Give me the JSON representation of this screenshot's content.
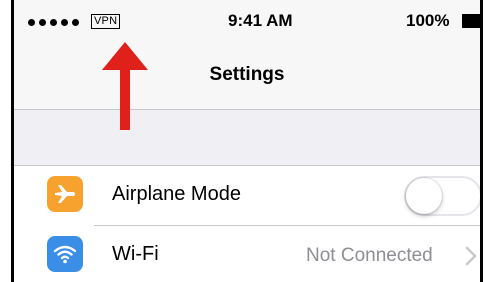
{
  "status_bar": {
    "vpn_label": "VPN",
    "time": "9:41 AM",
    "battery_percent": "100%",
    "signal_icon": "signal-dots-icon",
    "battery_icon": "battery-full-icon"
  },
  "nav": {
    "title": "Settings"
  },
  "rows": [
    {
      "label": "Airplane Mode",
      "icon": "airplane-icon",
      "icon_color": "#f7a12f",
      "toggle_on": false
    },
    {
      "label": "Wi-Fi",
      "icon": "wifi-icon",
      "icon_color": "#3a8ee6",
      "detail": "Not Connected",
      "chevron_icon": "chevron-right-icon"
    }
  ],
  "annotation": {
    "arrow_color": "#e0201b",
    "arrow_icon": "red-arrow-up-icon"
  }
}
